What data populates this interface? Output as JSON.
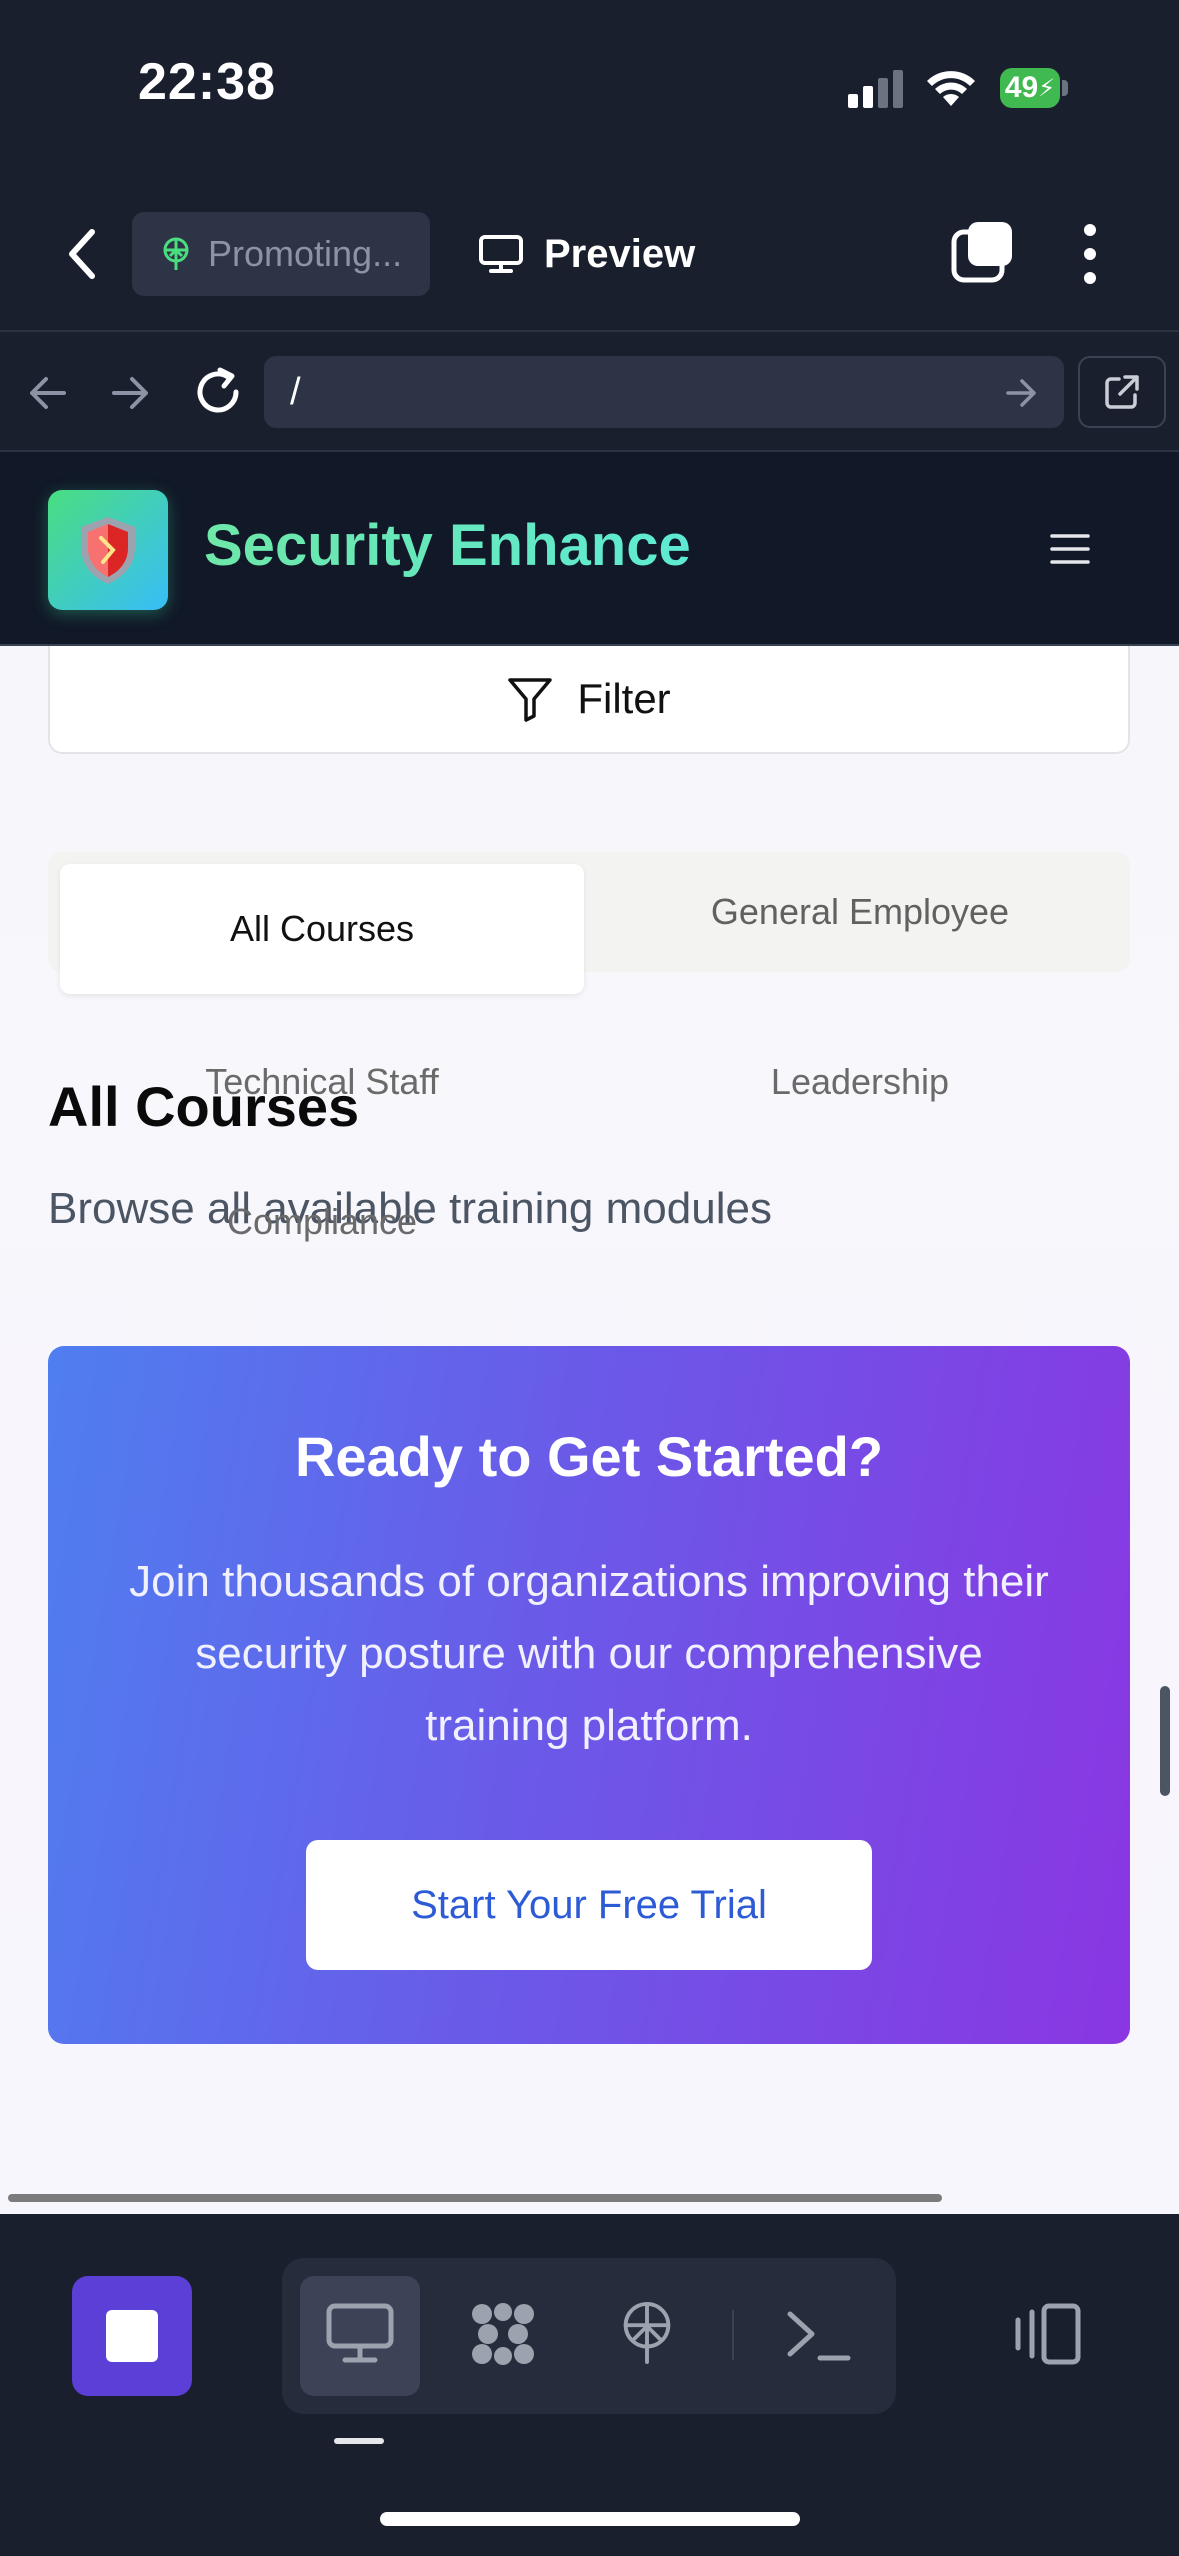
{
  "status_bar": {
    "time": "22:38",
    "battery": "49"
  },
  "top_bar": {
    "project_chip": "Promoting...",
    "preview_label": "Preview"
  },
  "browser": {
    "url": "/"
  },
  "site": {
    "title": "Security Enhance",
    "filter_label": "Filter",
    "tabs": [
      {
        "label": "All Courses",
        "active": true
      },
      {
        "label": "General Employee",
        "active": false
      },
      {
        "label": "Technical Staff",
        "active": false
      },
      {
        "label": "Leadership",
        "active": false
      },
      {
        "label": "Compliance",
        "active": false
      }
    ],
    "section": {
      "title": "All Courses",
      "subtitle": "Browse all available training modules"
    },
    "cta": {
      "title": "Ready to Get Started?",
      "body": "Join thousands of organizations improving their security posture with our comprehensive training platform.",
      "button": "Start Your Free Trial"
    }
  },
  "icons": {
    "back": "chevron-left-icon",
    "chip": "antenna-icon",
    "preview": "monitor-icon",
    "tabs": "tabs-icon",
    "more": "more-vertical-icon",
    "logo": "shield-icon",
    "menu": "hamburger-icon",
    "filter": "filter-icon",
    "toolbar": [
      "stop-icon",
      "monitor-icon",
      "apps-icon",
      "antenna-icon",
      "terminal-icon",
      "device-preview-icon"
    ]
  },
  "colors": {
    "app_bg": "#1a1f2e",
    "site_header_bg": "#111827",
    "brand_gradient_start": "#6ee7a8",
    "brand_gradient_end": "#5eead4",
    "cta_gradient_start": "#4f7ef0",
    "cta_gradient_end": "#8a36e2",
    "cta_button_text": "#2d5bd6",
    "stop_button": "#5b3fd6"
  }
}
